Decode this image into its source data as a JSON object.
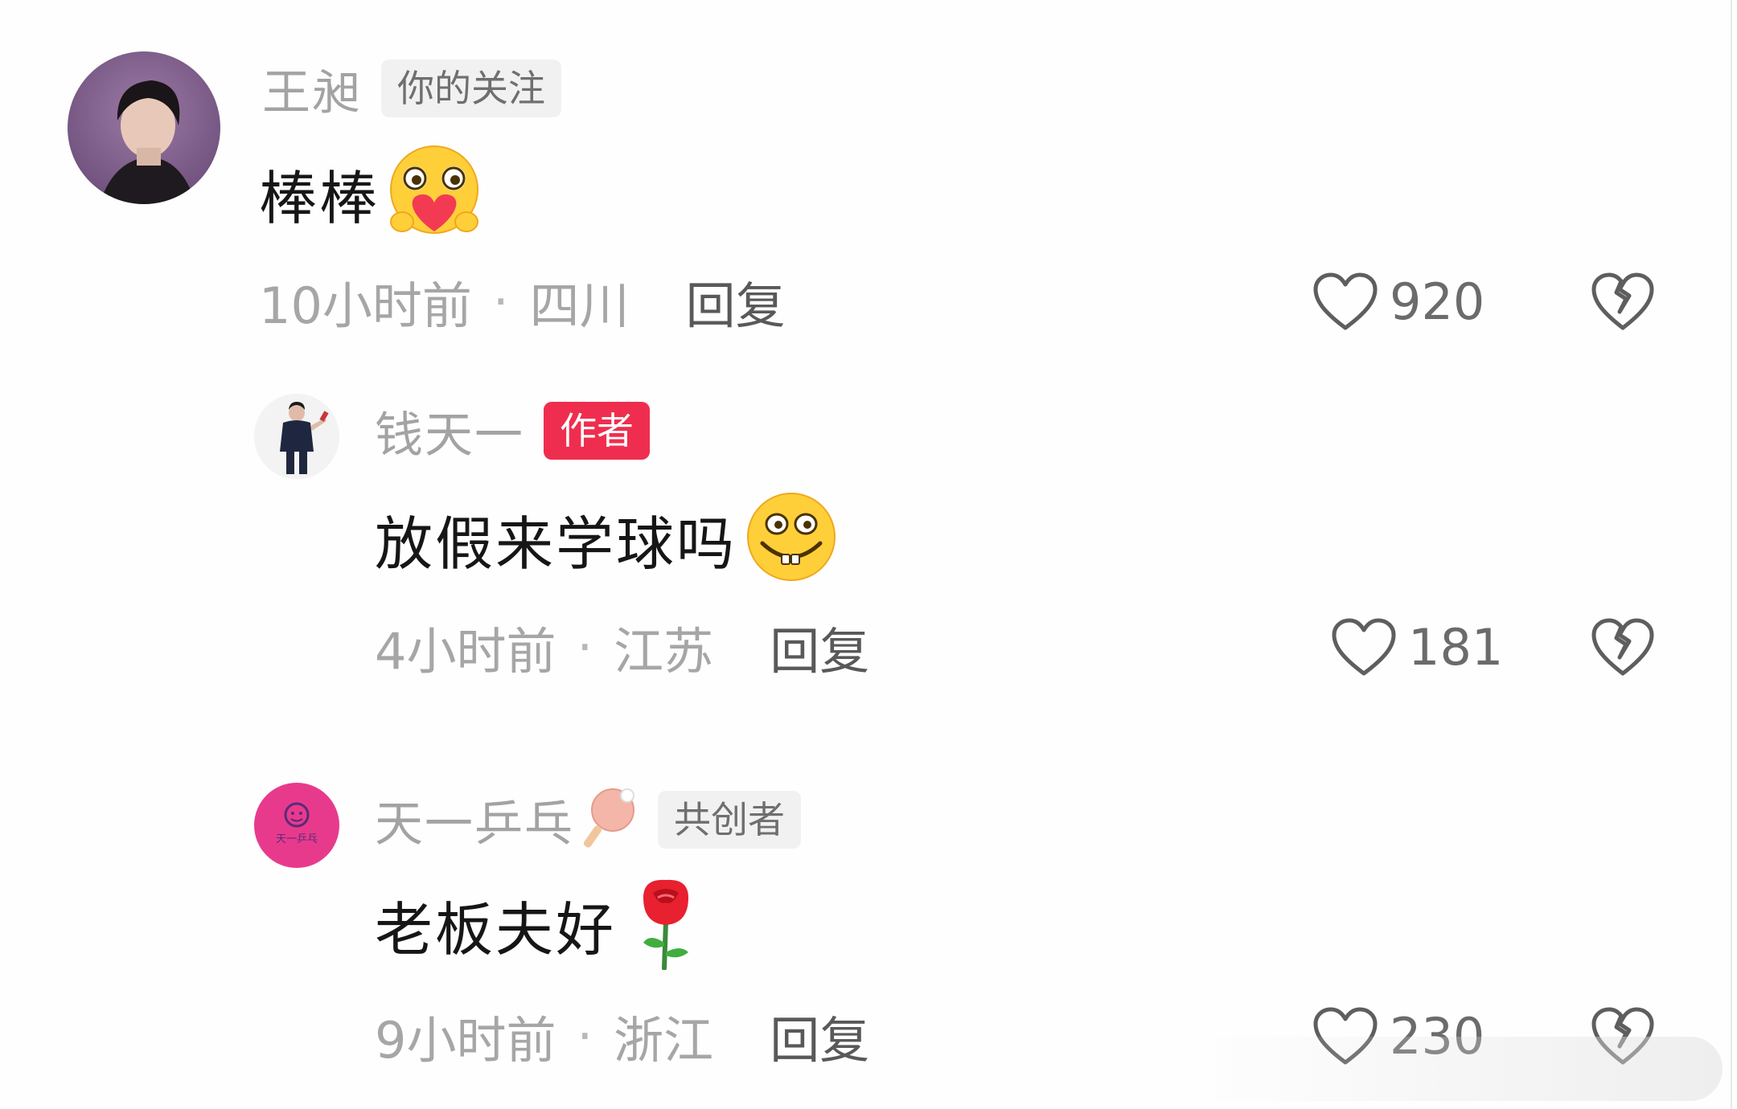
{
  "comments": [
    {
      "username": "王昶",
      "tag": "你的关注",
      "text": "棒棒",
      "emoji": "heart-hug-emoji",
      "time": "10小时前",
      "location": "四川",
      "reply_label": "回复",
      "likes": "920"
    },
    {
      "username": "钱天一",
      "tag": "作者",
      "text": "放假来学球吗",
      "emoji": "grinning-emoji",
      "time": "4小时前",
      "location": "江苏",
      "reply_label": "回复",
      "likes": "181"
    },
    {
      "username": "天一乒乓",
      "tag": "共创者",
      "text": "老板夫好",
      "emoji": "rose-emoji",
      "time": "9小时前",
      "location": "浙江",
      "reply_label": "回复",
      "likes": "230"
    }
  ],
  "separator": "·",
  "avatar_badge_text": "天一乒乓",
  "colors": {
    "author_tag": "#ef2e4f",
    "secondary_text": "#a3a3a3",
    "primary_text": "#161616",
    "avatar_pink": "#e83a8c"
  }
}
